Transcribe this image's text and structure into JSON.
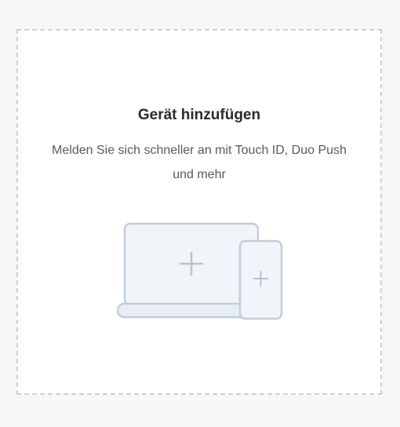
{
  "add_device": {
    "title": "Gerät hinzufügen",
    "description": "Melden Sie sich schneller an mit Touch ID, Duo Push und mehr",
    "illustration": "laptop-and-phone-add-icon",
    "colors": {
      "border": "#cfcfcf",
      "device_fill": "#f1f4f8",
      "device_stroke": "#c2cdd8",
      "plus": "#b9c4cf"
    }
  }
}
